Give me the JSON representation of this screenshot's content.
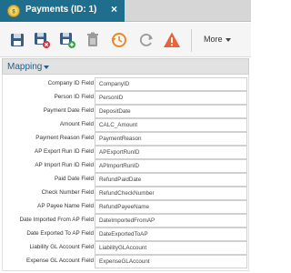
{
  "window": {
    "tab_title": "Payments (ID: 1)",
    "close_glyph": "×"
  },
  "toolbar": {
    "buttons": [
      {
        "name": "save-icon"
      },
      {
        "name": "save-and-close-icon"
      },
      {
        "name": "save-and-new-icon"
      },
      {
        "name": "delete-icon"
      },
      {
        "name": "history-icon"
      },
      {
        "name": "refresh-icon"
      },
      {
        "name": "warning-icon"
      }
    ],
    "more_label": "More"
  },
  "section": {
    "title": "Mapping"
  },
  "fields": [
    {
      "label": "Company ID Field",
      "value": "CompanyID"
    },
    {
      "label": "Person ID Field",
      "value": "PersonID"
    },
    {
      "label": "Payment Date Field",
      "value": "DepositDate"
    },
    {
      "label": "Amount Field",
      "value": "CALC_Amount"
    },
    {
      "label": "Payment Reason Field",
      "value": "PaymentReason"
    },
    {
      "label": "AP Export Run ID Field",
      "value": "APExportRunID"
    },
    {
      "label": "AP Import Run ID Field",
      "value": "APImportRunID"
    },
    {
      "label": "Paid Date Field",
      "value": "RefundPaidDate"
    },
    {
      "label": "Check Number Field",
      "value": "RefundCheckNumber"
    },
    {
      "label": "AP Payee Name Field",
      "value": "RefundPayeeName"
    },
    {
      "label": "Date Imported From AP Field",
      "value": "DateImportedFromAP"
    },
    {
      "label": "Date Exported To AP Field",
      "value": "DateExportedToAP"
    },
    {
      "label": "Liability GL Account Field",
      "value": "LiabilityGLAccount"
    },
    {
      "label": "Expense GL Account Field",
      "value": "ExpenseGLAccount"
    }
  ],
  "colors": {
    "tab": "#1f6e8e",
    "warning": "#e8633a",
    "history": "#e8892a",
    "save": "#3d5a80"
  }
}
